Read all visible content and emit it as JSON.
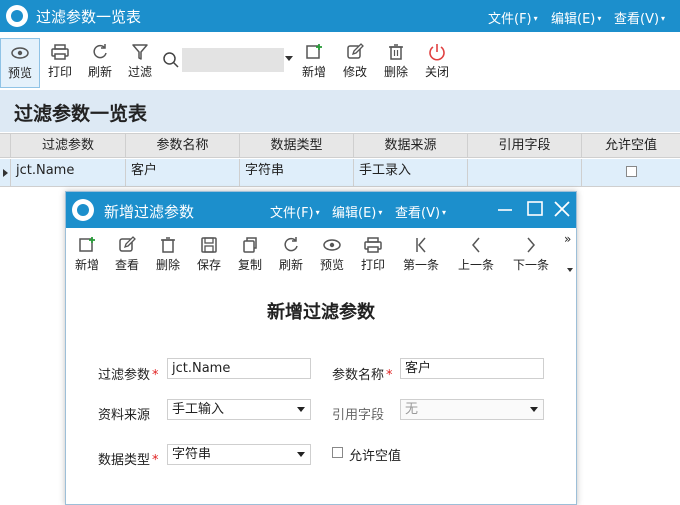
{
  "main": {
    "title": "过滤参数一览表",
    "menus": [
      "文件(F)",
      "编辑(E)",
      "查看(V)"
    ],
    "toolbar": {
      "preview": "预览",
      "print": "打印",
      "refresh": "刷新",
      "filter": "过滤",
      "new": "新增",
      "edit": "修改",
      "delete": "删除",
      "close": "关闭"
    },
    "search": {
      "value": ""
    },
    "page_title": "过滤参数一览表",
    "grid": {
      "columns": [
        "过滤参数",
        "参数名称",
        "数据类型",
        "数据来源",
        "引用字段",
        "允许空值"
      ],
      "rows": [
        {
          "filter_param": "jct.Name",
          "param_name": "客户",
          "data_type": "字符串",
          "data_source": "手工录入",
          "ref_field": "",
          "allow_null": false
        }
      ]
    }
  },
  "dialog": {
    "title": "新增过滤参数",
    "menus": [
      "文件(F)",
      "编辑(E)",
      "查看(V)"
    ],
    "toolbar": {
      "new": "新增",
      "view": "查看",
      "delete": "删除",
      "save": "保存",
      "copy": "复制",
      "refresh": "刷新",
      "preview": "预览",
      "print": "打印",
      "first": "第一条",
      "prev": "上一条",
      "next": "下一条",
      "more": "»"
    },
    "heading": "新增过滤参数",
    "form": {
      "filter_param_label": "过滤参数",
      "filter_param_value": "jct.Name",
      "param_name_label": "参数名称",
      "param_name_value": "客户",
      "source_label": "资料来源",
      "source_value": "手工输入",
      "ref_field_label": "引用字段",
      "ref_field_value": "无",
      "data_type_label": "数据类型",
      "data_type_value": "字符串",
      "allow_null_label": "允许空值",
      "allow_null_checked": false,
      "required_mark": "*"
    }
  },
  "colors": {
    "title_bar": "#1c8fcc",
    "header_band": "#dde9f4",
    "selected_row": "#dfeefa",
    "required": "#e02020",
    "close_icon": "#e04040"
  }
}
